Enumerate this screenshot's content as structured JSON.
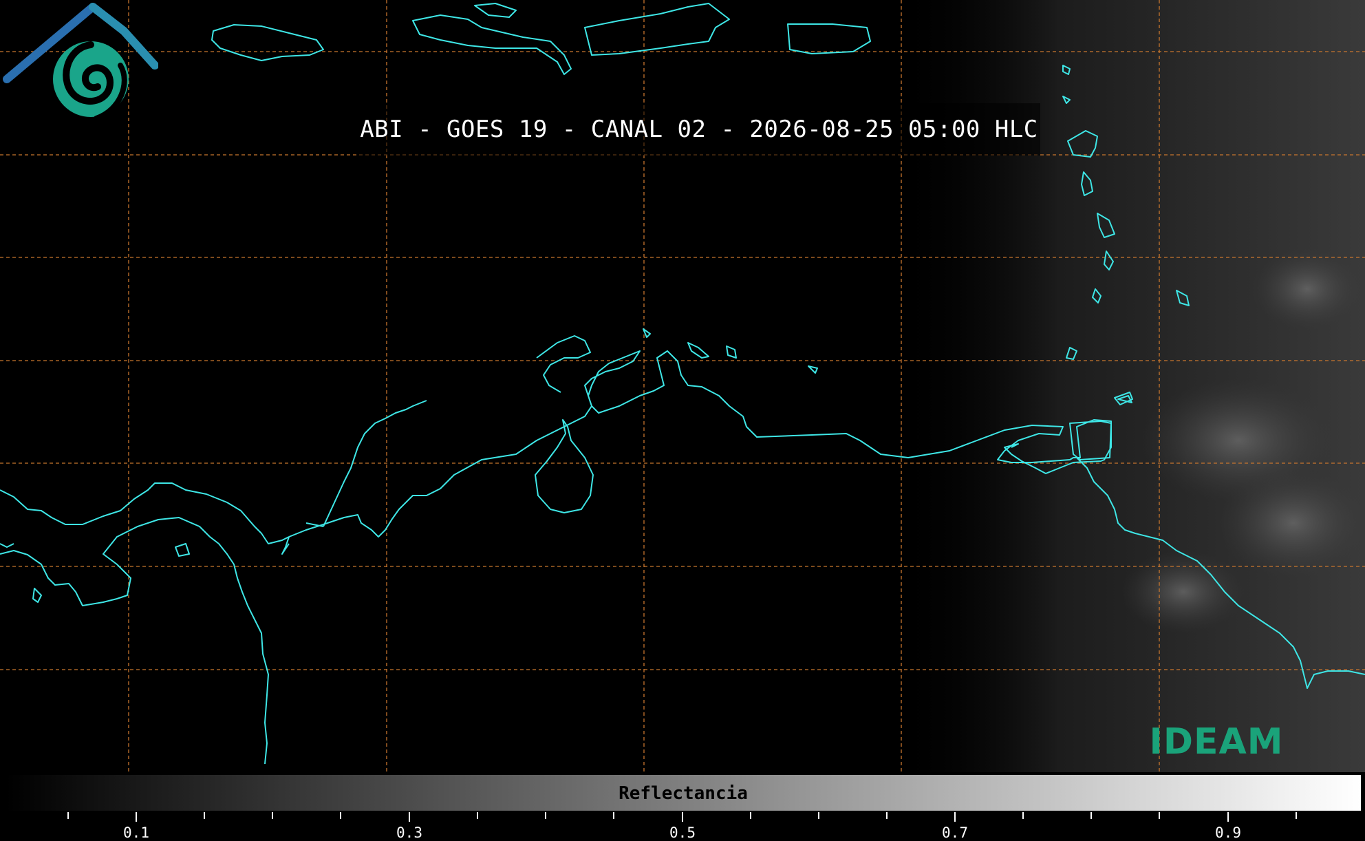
{
  "title": "ABI - GOES 19 - CANAL 02 - 2026-08-25 05:00 HLC",
  "colorbar": {
    "label": "Reflectancia",
    "ticks": [
      "0.1",
      "0.3",
      "0.5",
      "0.7",
      "0.9"
    ],
    "min": 0.0,
    "max": 1.0,
    "gradient_start": "#000000",
    "gradient_end": "#ffffff"
  },
  "logo": {
    "text": "IDEAM",
    "roof_color": "#2a6fb0",
    "swirl_color": "#1aa58a",
    "text_color": "#1aa37a"
  },
  "colors": {
    "coastline": "#3ee6e6",
    "gridline": "#c8762e",
    "background": "#000000"
  }
}
